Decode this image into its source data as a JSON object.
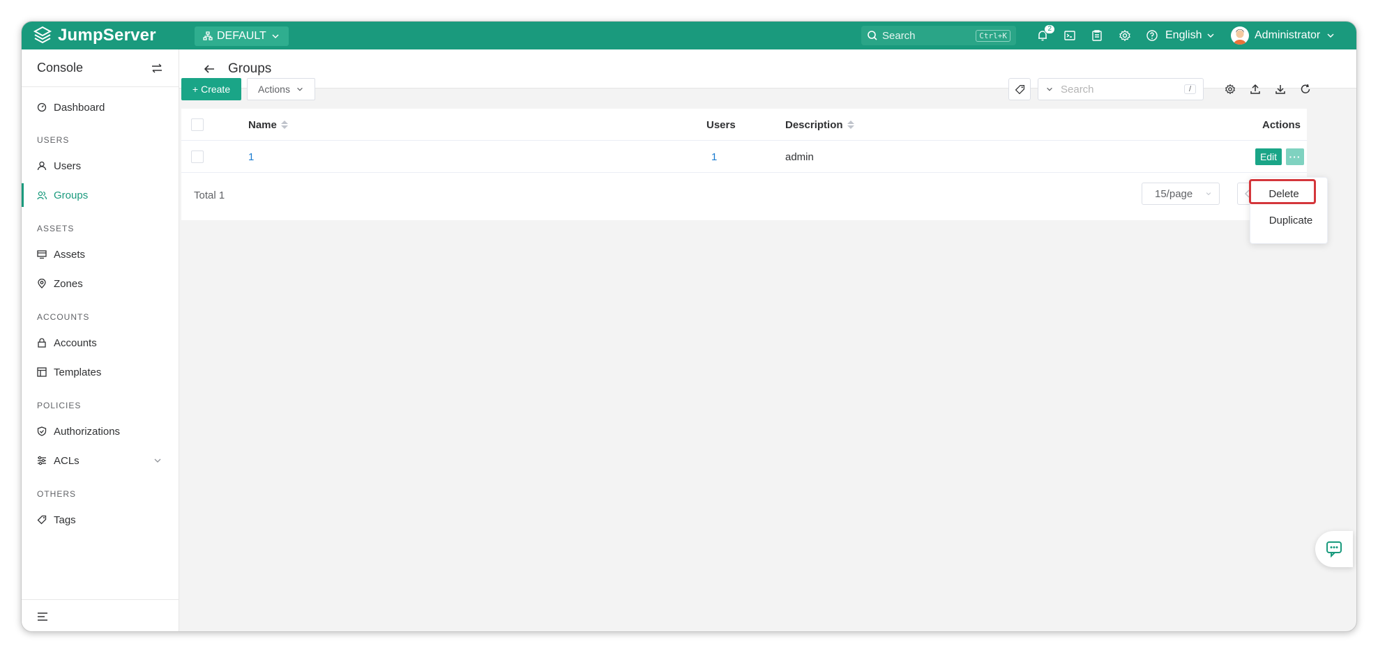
{
  "brand": {
    "name": "JumpServer"
  },
  "org": {
    "label": "DEFAULT"
  },
  "topbar": {
    "search_placeholder": "Search",
    "search_shortcut": "Ctrl+K",
    "notification_count": "2",
    "language": "English",
    "user": "Administrator"
  },
  "sidebar": {
    "title": "Console",
    "dashboard": "Dashboard",
    "sections": {
      "users": "USERS",
      "assets": "ASSETS",
      "accounts": "ACCOUNTS",
      "policies": "POLICIES",
      "others": "OTHERS"
    },
    "items": {
      "users": "Users",
      "groups": "Groups",
      "assets": "Assets",
      "zones": "Zones",
      "accounts": "Accounts",
      "templates": "Templates",
      "authorizations": "Authorizations",
      "acls": "ACLs",
      "tags": "Tags"
    }
  },
  "page": {
    "title": "Groups"
  },
  "toolbar": {
    "create_label": "Create",
    "actions_label": "Actions",
    "search_placeholder": "Search",
    "search_shortcut": "/"
  },
  "table": {
    "headers": {
      "name": "Name",
      "users": "Users",
      "description": "Description",
      "actions": "Actions"
    },
    "rows": [
      {
        "name": "1",
        "users": "1",
        "description": "admin",
        "edit": "Edit",
        "more": "···"
      }
    ],
    "total": "Total 1",
    "page_size": "15/page"
  },
  "dropdown": {
    "items": [
      "Delete",
      "Duplicate"
    ]
  },
  "colors": {
    "brand": "#1a9a7d",
    "highlight": "#d4363b",
    "link": "#1a7bd0"
  }
}
